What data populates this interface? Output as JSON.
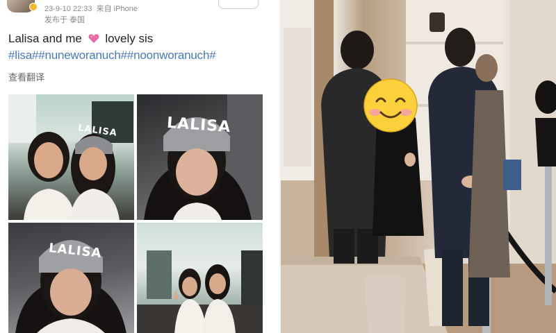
{
  "post": {
    "timestamp": "23-9-10 22:33",
    "source": "来自 iPhone",
    "location": "发布于 泰国",
    "caption_before": "Lalisa and me",
    "caption_after": "lovely sis",
    "hashtags": "#lisa##nuneworanuch##noonworanuch#",
    "translate_label": "查看翻译",
    "beanie_text": "LALISA",
    "colors": {
      "hashtag": "#4a7ab8",
      "meta": "#8a8a8a",
      "heart": "#e86aa8"
    }
  },
  "scene": {
    "emoji": "smiling-face-emoji",
    "description_icons": [
      "pink-heart-icon"
    ]
  }
}
